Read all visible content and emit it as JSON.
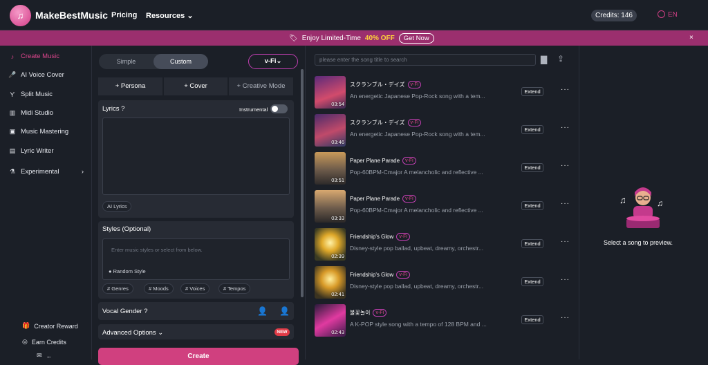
{
  "header": {
    "brand": "MakeBestMusic",
    "nav": [
      "Pricing",
      "Resources"
    ],
    "credits": "Credits: 146",
    "lang": "EN"
  },
  "promo": {
    "text": "Enjoy Limited-Time",
    "off": "40% OFF",
    "cta": "Get Now",
    "close": "×"
  },
  "sidebar": {
    "items": [
      "Create Music",
      "AI Voice Cover",
      "Split Music",
      "Midi Studio",
      "Music Mastering",
      "Lyric Writer",
      "Experimental"
    ],
    "bottom": [
      "Creator Reward",
      "Earn Credits"
    ]
  },
  "form": {
    "mode": {
      "simple": "Simple",
      "custom": "Custom"
    },
    "model": "v-Fi",
    "tabs": [
      "+ Persona",
      "+ Cover",
      "+ Creative Mode"
    ],
    "lyrics": {
      "label": "Lyrics",
      "instrumental": "Instrumental",
      "ai": "AI Lyrics"
    },
    "styles": {
      "label": "Styles (Optional)",
      "placeholder": "Enter music styles or select from below.",
      "random": "Random Style",
      "chips": [
        "# Genres",
        "# Moods",
        "# Voices",
        "# Tempos"
      ]
    },
    "vocal_gender": "Vocal Gender",
    "advanced": "Advanced Options",
    "new_badge": "NEW",
    "create": "Create"
  },
  "list": {
    "search_placeholder": "please enter the song title to search",
    "tag": "v-Fi",
    "extend": "Extend",
    "songs": [
      {
        "title": "スクランブル・デイズ",
        "desc": "An energetic Japanese Pop-Rock song with a tem...",
        "dur": "03:54"
      },
      {
        "title": "スクランブル・デイズ",
        "desc": "An energetic Japanese Pop-Rock song with a tem...",
        "dur": "03:46"
      },
      {
        "title": "Paper Plane Parade",
        "desc": "Pop-60BPM-Cmajor A melancholic and reflective ...",
        "dur": "03:51"
      },
      {
        "title": "Paper Plane Parade",
        "desc": "Pop-60BPM-Cmajor A melancholic and reflective ...",
        "dur": "03:33"
      },
      {
        "title": "Friendship's Glow",
        "desc": "Disney-style pop ballad, upbeat, dreamy, orchestr...",
        "dur": "02:39"
      },
      {
        "title": "Friendship's Glow",
        "desc": "Disney-style pop ballad, upbeat, dreamy, orchestr...",
        "dur": "02:41"
      },
      {
        "title": "불꽃놀이",
        "desc": "A K-POP style song with a tempo of 128 BPM and ...",
        "dur": "02:43"
      }
    ]
  },
  "preview": {
    "text": "Select a song to preview."
  }
}
